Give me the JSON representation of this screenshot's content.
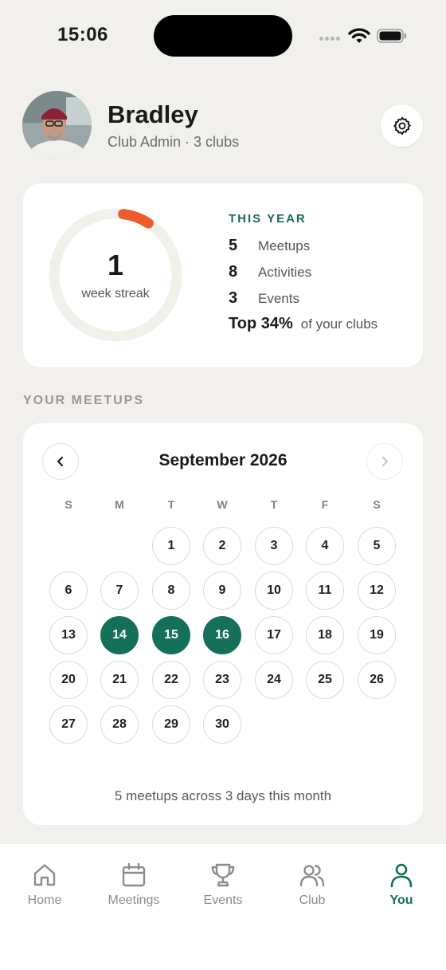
{
  "status_bar": {
    "time": "15:06"
  },
  "profile": {
    "name": "Bradley",
    "subtitle": "Club Admin · 3 clubs"
  },
  "streak": {
    "value": "1",
    "label": "week streak",
    "progress": 0.07
  },
  "this_year": {
    "title": "THIS YEAR",
    "stats": [
      {
        "value": "5",
        "label": "Meetups"
      },
      {
        "value": "8",
        "label": "Activities"
      },
      {
        "value": "3",
        "label": "Events"
      }
    ],
    "top": {
      "value": "Top 34%",
      "label": "of your clubs"
    }
  },
  "meetups": {
    "section_title": "YOUR MEETUPS",
    "month_label": "September 2026",
    "weekdays": [
      "S",
      "M",
      "T",
      "W",
      "T",
      "F",
      "S"
    ],
    "first_weekday": 2,
    "days_in_month": 30,
    "active_days": [
      14,
      15,
      16
    ],
    "summary": "5 meetups across 3 days this month"
  },
  "tabs": [
    {
      "label": "Home",
      "icon": "home-icon",
      "selected": false
    },
    {
      "label": "Meetings",
      "icon": "calendar-icon",
      "selected": false
    },
    {
      "label": "Events",
      "icon": "trophy-icon",
      "selected": false
    },
    {
      "label": "Club",
      "icon": "users-icon",
      "selected": false
    },
    {
      "label": "You",
      "icon": "user-icon",
      "selected": true
    }
  ],
  "colors": {
    "accent": "#15705a",
    "streak": "#ef5a2e",
    "background": "#f1f0ec"
  }
}
